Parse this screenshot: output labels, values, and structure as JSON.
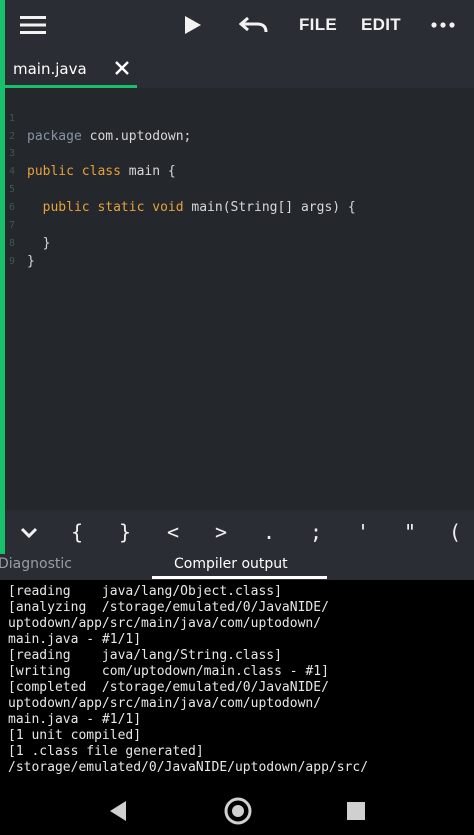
{
  "toolbar": {
    "menu_icon": "hamburger-menu-icon",
    "run_icon": "play-icon",
    "undo_icon": "undo-icon",
    "file_label": "FILE",
    "edit_label": "EDIT",
    "more_icon": "more-horizontal-icon"
  },
  "tabs": [
    {
      "label": "main.java",
      "close_icon": "close-icon",
      "active": true
    }
  ],
  "editor": {
    "lines": [
      {
        "n": "1",
        "t1": "package",
        "t2": " com.uptodown;",
        "t3": "",
        "t4": "",
        "t5": "",
        "t6": ""
      },
      {
        "n": "2",
        "t1": "",
        "t2": "",
        "t3": "",
        "t4": "",
        "t5": "",
        "t6": ""
      },
      {
        "n": "3",
        "t1": "public",
        "t2": " ",
        "t3": "class",
        "t4": " main {",
        "t5": "",
        "t6": ""
      },
      {
        "n": "4",
        "t1": "",
        "t2": "",
        "t3": "",
        "t4": "",
        "t5": "",
        "t6": ""
      },
      {
        "n": "5",
        "t1": "  public",
        "t2": " ",
        "t3": "static",
        "t4": " ",
        "t5": "void",
        "t6": " main(String[] args) {"
      },
      {
        "n": "6",
        "t1": "",
        "t2": "",
        "t3": "",
        "t4": "",
        "t5": "",
        "t6": ""
      },
      {
        "n": "7",
        "t1": "  }",
        "t2": "",
        "t3": "",
        "t4": "",
        "t5": "",
        "t6": ""
      },
      {
        "n": "8",
        "t1": "}",
        "t2": "",
        "t3": "",
        "t4": "",
        "t5": "",
        "t6": ""
      },
      {
        "n": "9",
        "t1": "",
        "t2": "",
        "t3": "",
        "t4": "",
        "t5": "",
        "t6": ""
      }
    ]
  },
  "symbols": {
    "collapse_icon": "chevron-down-icon",
    "keys": [
      "{",
      "}",
      "<",
      ">",
      ".",
      ";",
      "'",
      "\"",
      "("
    ]
  },
  "panel_tabs": {
    "diagnostic": "Diagnostic",
    "compiler_output": "Compiler output"
  },
  "output": {
    "lines": [
      "[reading    java/lang/Object.class]",
      "[analyzing  /storage/emulated/0/JavaNIDE/",
      "uptodown/app/src/main/java/com/uptodown/",
      "main.java - #1/1]",
      "[reading    java/lang/String.class]",
      "[writing    com/uptodown/main.class - #1]",
      "[completed  /storage/emulated/0/JavaNIDE/",
      "uptodown/app/src/main/java/com/uptodown/",
      "main.java - #1/1]",
      "[1 unit compiled]",
      "[1 .class file generated]",
      "/storage/emulated/0/JavaNIDE/uptodown/app/src/"
    ]
  },
  "navbar": {
    "back_icon": "back-triangle-icon",
    "home_icon": "home-circle-icon",
    "recents_icon": "recents-square-icon"
  },
  "colors": {
    "accent": "#19c06b",
    "keyword": "#e6a23c",
    "background": "#23262b"
  }
}
